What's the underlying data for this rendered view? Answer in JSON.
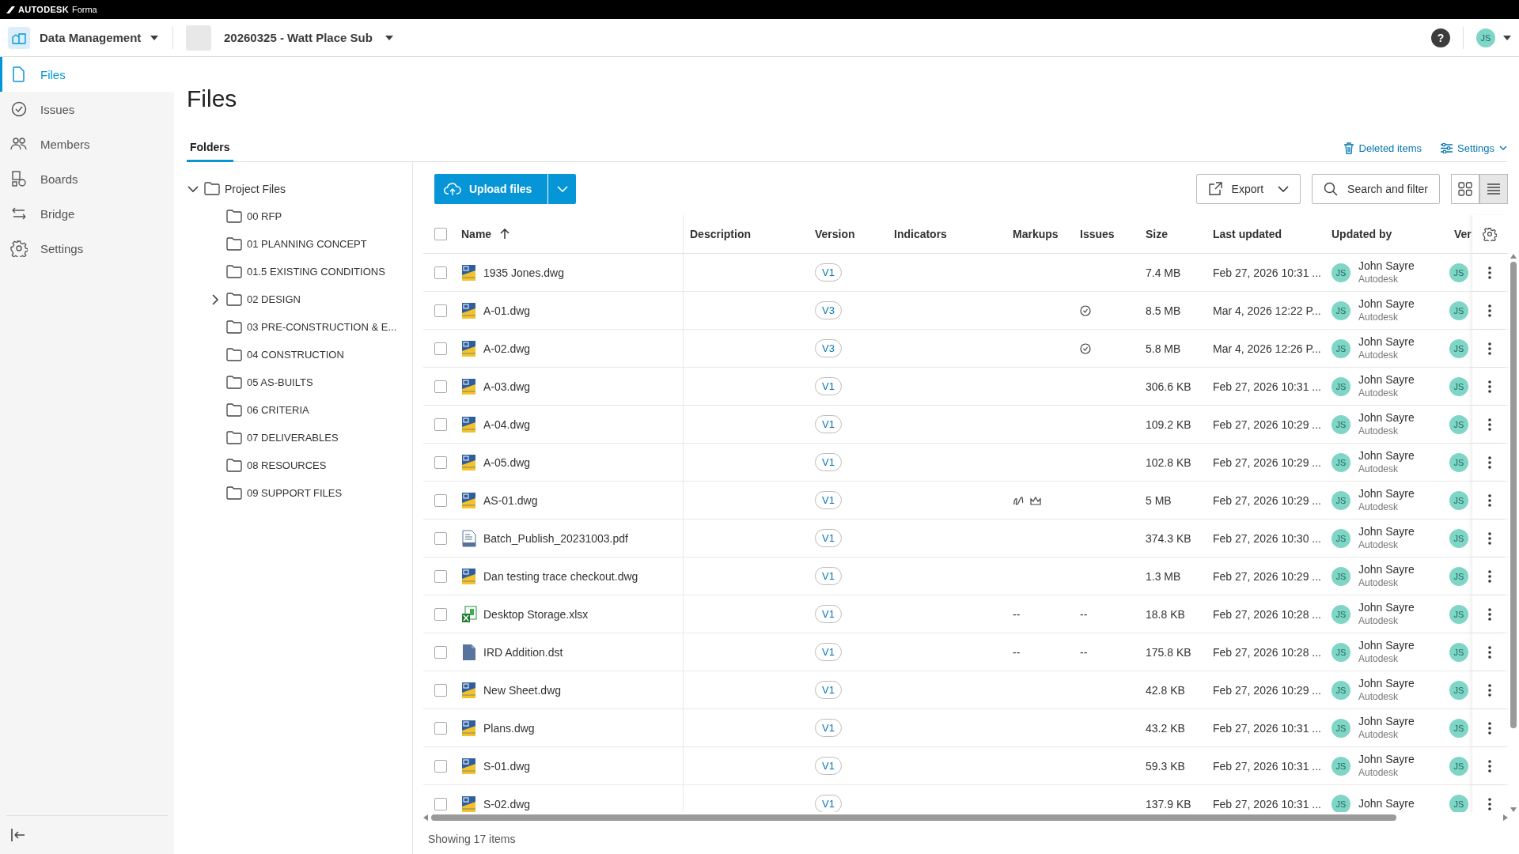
{
  "top_bar": {
    "brand": "AUTODESK",
    "product": "Forma"
  },
  "header": {
    "app": "Data Management",
    "project": "20260325 - Watt Place Sub",
    "help": "?",
    "user_initials": "JS"
  },
  "sidebar": {
    "items": [
      {
        "label": "Files",
        "selected": true
      },
      {
        "label": "Issues",
        "selected": false
      },
      {
        "label": "Members",
        "selected": false
      },
      {
        "label": "Boards",
        "selected": false
      },
      {
        "label": "Bridge",
        "selected": false
      },
      {
        "label": "Settings",
        "selected": false
      }
    ]
  },
  "page": {
    "title": "Files",
    "tabs": [
      {
        "label": "Folders",
        "selected": true
      }
    ],
    "links": [
      "Deleted items",
      "Settings"
    ]
  },
  "folders": {
    "label": "Project Files",
    "expanded": true,
    "children": [
      {
        "label": "00 RFP"
      },
      {
        "label": "01 PLANNING CONCEPT"
      },
      {
        "label": "01.5 EXISTING CONDITIONS"
      },
      {
        "label": "02 DESIGN",
        "expanded": false
      },
      {
        "label": "03 PRE-CONSTRUCTION & E..."
      },
      {
        "label": "04 CONSTRUCTION"
      },
      {
        "label": "05 AS-BUILTS"
      },
      {
        "label": "06 CRITERIA"
      },
      {
        "label": "07 DELIVERABLES"
      },
      {
        "label": "08 RESOURCES"
      },
      {
        "label": "09 SUPPORT FILES"
      }
    ]
  },
  "toolbar": {
    "upload": "Upload files",
    "export": "Export",
    "search": "Search and filter",
    "view_modes": [
      {
        "selected": false
      },
      {
        "selected": true
      }
    ]
  },
  "table": {
    "select_all": {
      "checked": false
    },
    "columns": [
      {
        "label": "Name",
        "sort_ascending": true
      },
      {
        "label": "Description"
      },
      {
        "label": "Version"
      },
      {
        "label": "Indicators"
      },
      {
        "label": "Markups"
      },
      {
        "label": "Issues"
      },
      {
        "label": "Size"
      },
      {
        "label": "Last updated"
      },
      {
        "label": "Updated by"
      },
      {
        "label": "Ver"
      }
    ],
    "rows": [
      {
        "checked": false,
        "kind": "dwg",
        "name": "1935 Jones.dwg",
        "version": "V1",
        "size": "7.4 MB",
        "last_updated": "Feb 27, 2026 10:31 ...",
        "updated_by": "John Sayre",
        "company": "Autodesk",
        "initials": "JS",
        "ver_initials": "JS"
      },
      {
        "checked": false,
        "kind": "dwg",
        "name": "A-01.dwg",
        "version": "V3",
        "issue_icon": true,
        "size": "8.5 MB",
        "last_updated": "Mar 4, 2026 12:22 P...",
        "updated_by": "John Sayre",
        "company": "Autodesk",
        "initials": "JS",
        "ver_initials": "JS"
      },
      {
        "checked": false,
        "kind": "dwg",
        "name": "A-02.dwg",
        "version": "V3",
        "issue_icon": true,
        "size": "5.8 MB",
        "last_updated": "Mar 4, 2026 12:26 P...",
        "updated_by": "John Sayre",
        "company": "Autodesk",
        "initials": "JS",
        "ver_initials": "JS"
      },
      {
        "checked": false,
        "kind": "dwg",
        "name": "A-03.dwg",
        "version": "V1",
        "size": "306.6 KB",
        "last_updated": "Feb 27, 2026 10:31 ...",
        "updated_by": "John Sayre",
        "company": "Autodesk",
        "initials": "JS",
        "ver_initials": "JS"
      },
      {
        "checked": false,
        "kind": "dwg",
        "name": "A-04.dwg",
        "version": "V1",
        "size": "109.2 KB",
        "last_updated": "Feb 27, 2026 10:29 ...",
        "updated_by": "John Sayre",
        "company": "Autodesk",
        "initials": "JS",
        "ver_initials": "JS"
      },
      {
        "checked": false,
        "kind": "dwg",
        "name": "A-05.dwg",
        "version": "V1",
        "size": "102.8 KB",
        "last_updated": "Feb 27, 2026 10:29 ...",
        "updated_by": "John Sayre",
        "company": "Autodesk",
        "initials": "JS",
        "ver_initials": "JS"
      },
      {
        "checked": false,
        "kind": "dwg",
        "name": "AS-01.dwg",
        "version": "V1",
        "markup_icons": true,
        "size": "5 MB",
        "last_updated": "Feb 27, 2026 10:29 ...",
        "updated_by": "John Sayre",
        "company": "Autodesk",
        "initials": "JS",
        "ver_initials": "JS"
      },
      {
        "checked": false,
        "kind": "pdf",
        "name": "Batch_Publish_20231003.pdf",
        "version": "V1",
        "size": "374.3 KB",
        "last_updated": "Feb 27, 2026 10:30 ...",
        "updated_by": "John Sayre",
        "company": "Autodesk",
        "initials": "JS",
        "ver_initials": "JS"
      },
      {
        "checked": false,
        "kind": "dwg",
        "name": "Dan testing trace checkout.dwg",
        "version": "V1",
        "size": "1.3 MB",
        "last_updated": "Feb 27, 2026 10:29 ...",
        "updated_by": "John Sayre",
        "company": "Autodesk",
        "initials": "JS",
        "ver_initials": "JS"
      },
      {
        "checked": false,
        "kind": "xlsx",
        "name": "Desktop Storage.xlsx",
        "version": "V1",
        "markups": "--",
        "issues": "--",
        "size": "18.8 KB",
        "last_updated": "Feb 27, 2026 10:28 ...",
        "updated_by": "John Sayre",
        "company": "Autodesk",
        "initials": "JS",
        "ver_initials": "JS"
      },
      {
        "checked": false,
        "kind": "dst",
        "name": "IRD Addition.dst",
        "version": "V1",
        "markups": "--",
        "issues": "--",
        "size": "175.8 KB",
        "last_updated": "Feb 27, 2026 10:28 ...",
        "updated_by": "John Sayre",
        "company": "Autodesk",
        "initials": "JS",
        "ver_initials": "JS"
      },
      {
        "checked": false,
        "kind": "dwg",
        "name": "New Sheet.dwg",
        "version": "V1",
        "size": "42.8 KB",
        "last_updated": "Feb 27, 2026 10:29 ...",
        "updated_by": "John Sayre",
        "company": "Autodesk",
        "initials": "JS",
        "ver_initials": "JS"
      },
      {
        "checked": false,
        "kind": "dwg",
        "name": "Plans.dwg",
        "version": "V1",
        "size": "43.2 KB",
        "last_updated": "Feb 27, 2026 10:31 ...",
        "updated_by": "John Sayre",
        "company": "Autodesk",
        "initials": "JS",
        "ver_initials": "JS"
      },
      {
        "checked": false,
        "kind": "dwg",
        "name": "S-01.dwg",
        "version": "V1",
        "size": "59.3 KB",
        "last_updated": "Feb 27, 2026 10:31 ...",
        "updated_by": "John Sayre",
        "company": "Autodesk",
        "initials": "JS",
        "ver_initials": "JS"
      },
      {
        "checked": false,
        "kind": "dwg",
        "name": "S-02.dwg",
        "version": "V1",
        "size": "137.9 KB",
        "last_updated": "Feb 27, 2026 10:31 ...",
        "updated_by": "John Sayre",
        "initials": "JS",
        "ver_initials": "JS"
      }
    ]
  },
  "footer": "Showing 17 items"
}
